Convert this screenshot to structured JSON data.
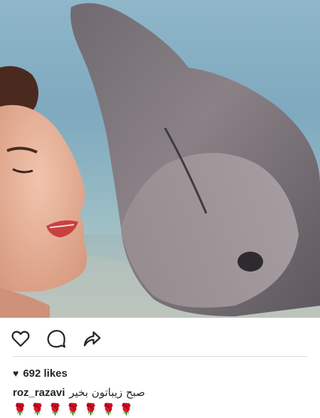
{
  "post": {
    "actions": {
      "like_icon": "heart-outline-icon",
      "comment_icon": "comment-bubble-icon",
      "share_icon": "share-arrow-icon"
    },
    "likes": {
      "heart_glyph": "♥",
      "label": "692 likes"
    },
    "caption": {
      "username": "roz_razavi",
      "text": "صبح زیباتون بخیر"
    },
    "emojis": [
      "🌹",
      "🌹",
      "🌹",
      "🌹",
      "🌹",
      "🌹",
      "🌹"
    ]
  },
  "colors": {
    "text": "#262626",
    "divider": "#dbdbdb",
    "rose": "#d11a2a"
  }
}
